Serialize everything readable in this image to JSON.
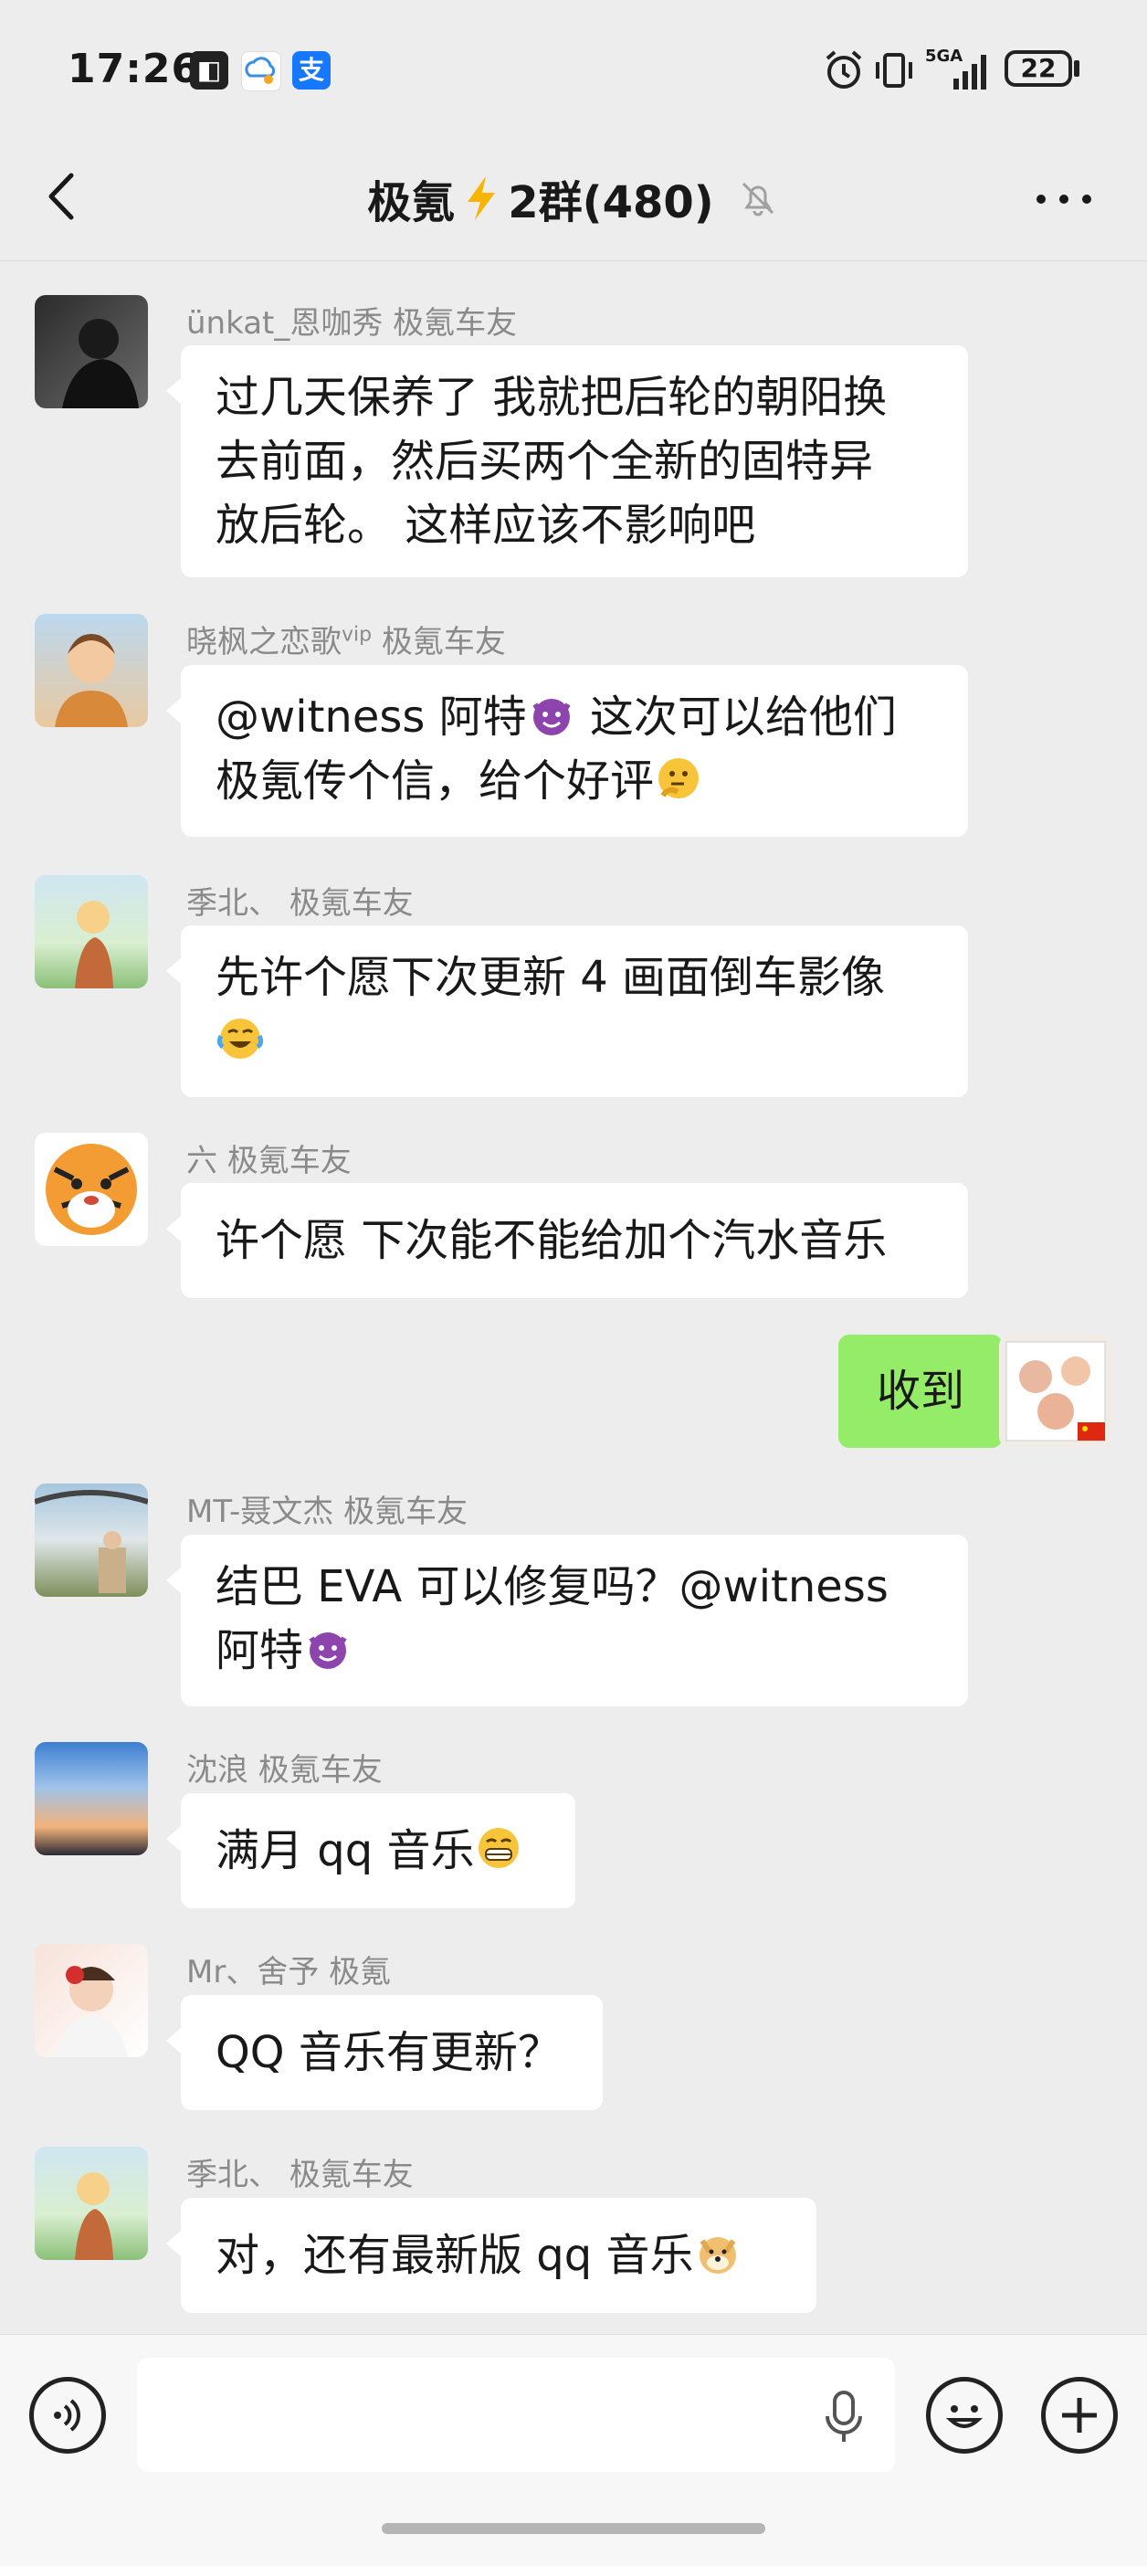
{
  "status_bar": {
    "time": "17:26",
    "network": "5GA",
    "battery": "22",
    "icons": [
      "notification-app-icon",
      "cloud-chat-icon",
      "alipay-icon",
      "alarm-icon",
      "vibrate-icon",
      "signal-icon"
    ]
  },
  "nav": {
    "title": "极氪",
    "title_suffix": "2群(480)",
    "icons": [
      "back-icon",
      "lightning-icon",
      "mute-bell-icon",
      "more-icon"
    ]
  },
  "messages": [
    {
      "sender": "ünkat_恩咖秀 极氪车友",
      "lines": [
        "过几天保养了 我就把后轮的朝阳换",
        "去前面，然后买两个全新的固特异",
        "放后轮。 这样应该不影响吧"
      ],
      "avatar": "dark-portrait"
    },
    {
      "sender": "晓枫之恋歌",
      "sender_sup": "vip",
      "sender_tail": " 极氪车友",
      "lines": [
        "@witness 阿特",
        "极氪传个信，给个好评"
      ],
      "line1_after": " 这次可以给他们",
      "avatar": "boy-cartoon"
    },
    {
      "sender": "季北、 极氪车友",
      "lines": [
        "先许个愿下次更新 4 画面倒车影像"
      ],
      "avatar": "girl-field"
    },
    {
      "sender": "六 极氪车友",
      "lines": [
        "许个愿 下次能不能给加个汽水音乐"
      ],
      "avatar": "tiger"
    },
    {
      "sender": "",
      "mine": true,
      "lines": [
        "收到"
      ],
      "avatar": "photo-collage"
    },
    {
      "sender": "MT-聂文杰 极氪车友",
      "lines": [
        "结巴 EVA 可以修复吗？@witness",
        "阿特"
      ],
      "avatar": "landscape"
    },
    {
      "sender": "沈浪 极氪车友",
      "lines": [
        "满月 qq 音乐"
      ],
      "avatar": "sunset-sky"
    },
    {
      "sender": "Mr、舍予 极氪",
      "lines": [
        "QQ 音乐有更新？"
      ],
      "avatar": "child-photo"
    },
    {
      "sender": "季北、 极氪车友",
      "lines": [
        "对，还有最新版 qq 音乐"
      ],
      "avatar": "girl-field"
    }
  ],
  "input_bar": {
    "value": "",
    "icons": [
      "voice-icon",
      "microphone-icon",
      "emoji-icon",
      "plus-icon"
    ]
  },
  "colors": {
    "background": "#ededed",
    "bubble": "#ffffff",
    "my_bubble": "#95ec69",
    "sender_text": "#8a8a8a"
  }
}
